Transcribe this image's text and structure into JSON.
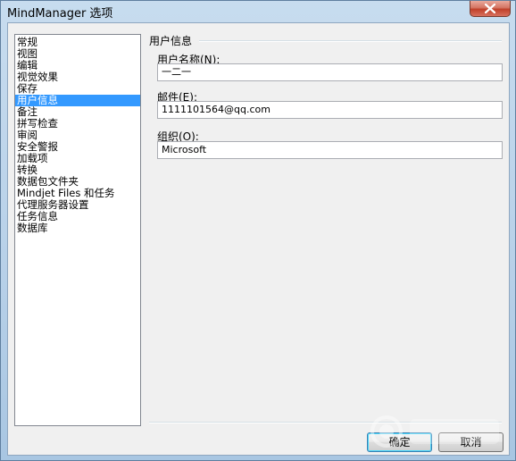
{
  "window": {
    "title": "MindManager 选项"
  },
  "sidebar": {
    "items": [
      {
        "label": "常规",
        "selected": false
      },
      {
        "label": "视图",
        "selected": false
      },
      {
        "label": "编辑",
        "selected": false
      },
      {
        "label": "视觉效果",
        "selected": false
      },
      {
        "label": "保存",
        "selected": false
      },
      {
        "label": "用户信息",
        "selected": true
      },
      {
        "label": "备注",
        "selected": false
      },
      {
        "label": "拼写检查",
        "selected": false
      },
      {
        "label": "审阅",
        "selected": false
      },
      {
        "label": "安全警报",
        "selected": false
      },
      {
        "label": "加载项",
        "selected": false
      },
      {
        "label": "转换",
        "selected": false
      },
      {
        "label": "数据包文件夹",
        "selected": false
      },
      {
        "label": "Mindjet Files 和任务",
        "selected": false
      },
      {
        "label": "代理服务器设置",
        "selected": false
      },
      {
        "label": "任务信息",
        "selected": false
      },
      {
        "label": "数据库",
        "selected": false
      }
    ]
  },
  "main": {
    "group_title": "用户信息",
    "username": {
      "label": "用户名称(N):",
      "value": "一二一"
    },
    "email": {
      "label": "邮件(E):",
      "value": "1111101564@qq.com"
    },
    "organization": {
      "label": "组织(O):",
      "value": "Microsoft"
    }
  },
  "footer": {
    "ok_label": "确定",
    "cancel_label": "取消"
  },
  "colors": {
    "selection": "#3399ff",
    "title_bar": "#b7d0e8",
    "close_button": "#c0402a"
  },
  "icons": {
    "close": "close-icon"
  }
}
